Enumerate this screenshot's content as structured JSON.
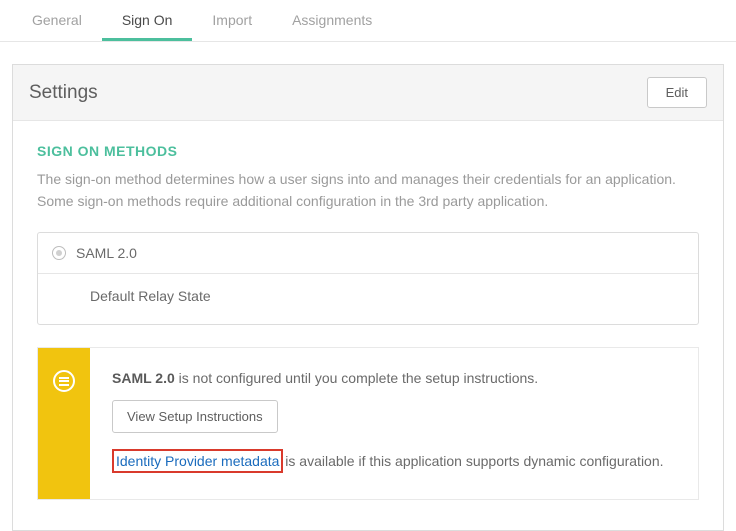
{
  "tabs": {
    "general": "General",
    "sign_on": "Sign On",
    "import": "Import",
    "assignments": "Assignments"
  },
  "settings": {
    "title": "Settings",
    "edit_label": "Edit",
    "section_heading": "SIGN ON METHODS",
    "section_desc": "The sign-on method determines how a user signs into and manages their credentials for an application. Some sign-on methods require additional configuration in the 3rd party application.",
    "method_name": "SAML 2.0",
    "relay_state_label": "Default Relay State",
    "info_bold": "SAML 2.0",
    "info_rest": " is not configured until you complete the setup instructions.",
    "setup_button": "View Setup Instructions",
    "meta_link": "Identity Provider metadata",
    "meta_rest": " is available if this application supports dynamic configuration."
  }
}
